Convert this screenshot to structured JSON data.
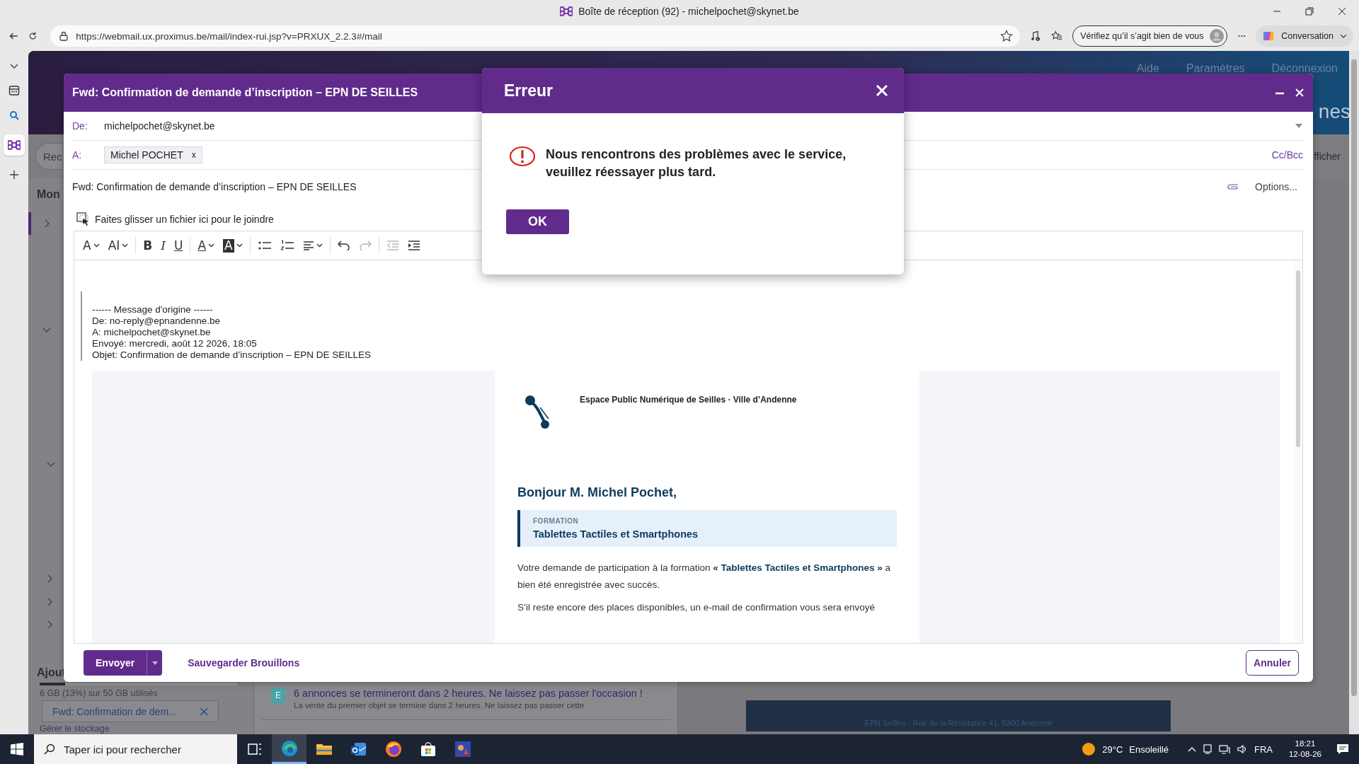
{
  "browser": {
    "tab_title": "Boîte de réception (92) - michelpochet@skynet.be",
    "url": "https://webmail.ux.proximus.be/mail/index-rui.jsp?v=PRXUX_2.2.3#/mail",
    "identity_button": "Vérifiez qu’il s’agit bien de vous",
    "copilot_button": "Conversation"
  },
  "webmail": {
    "header_links": [
      "Aide",
      "Paramètres",
      "Déconnexion"
    ],
    "header_title": "nes",
    "toolbar_button": "Rec",
    "view_menu": "fficher",
    "folder_heading": "Mon",
    "storage_heading": "Ajout",
    "storage": {
      "level": 0.13,
      "text": "6 GB (13%) sur 50 GB utilisés",
      "link": "Gérer le stockage"
    },
    "notification": {
      "badge": "E",
      "title": "6 annonces se termineront dans 2 heures. Ne laissez pas passer l'occasion !",
      "preview": "La vente du premier objet se termine dans 2 heures. Ne laissez pas passer cette"
    },
    "preview_footer": "EPN Seilles · Rue de la Résistance 41, 5300 Andenne",
    "minimized_draft": "Fwd: Confirmation de dem..."
  },
  "compose": {
    "title": "Fwd: Confirmation de demande d’inscription – EPN DE SEILLES",
    "from_label": "De:",
    "from": "michelpochet@skynet.be",
    "to_label": "A:",
    "recipients": [
      {
        "name": "Michel POCHET",
        "remove": "x"
      }
    ],
    "cc_bcc": "Cc/Bcc",
    "subject": "Fwd: Confirmation de demande d’inscription – EPN DE SEILLES",
    "options": "Options...",
    "attach_hint": "Faites glisser un fichier ici pour le joindre",
    "toolbar": [
      {
        "kind": "font",
        "text": "A",
        "disabled": false
      },
      {
        "kind": "size",
        "text": "AI",
        "disabled": false
      },
      {
        "kind": "bold",
        "text": "B",
        "disabled": false
      },
      {
        "kind": "italic",
        "text": "I",
        "disabled": false
      },
      {
        "kind": "underline",
        "text": "U",
        "disabled": false
      },
      {
        "kind": "color",
        "text": "A",
        "disabled": false
      },
      {
        "kind": "highlight",
        "text": "A",
        "disabled": false
      },
      {
        "kind": "bullets",
        "disabled": false
      },
      {
        "kind": "numbers",
        "disabled": false
      },
      {
        "kind": "align",
        "disabled": false
      },
      {
        "kind": "undo",
        "disabled": false
      },
      {
        "kind": "redo",
        "disabled": true
      },
      {
        "kind": "outdent",
        "disabled": true
      },
      {
        "kind": "indent",
        "disabled": false
      }
    ],
    "quote": [
      "------ Message d'origine ------",
      "De: no-reply@epnandenne.be",
      "A: michelpochet@skynet.be",
      "Envoyé: mercredi, août 12 2026, 18:05",
      "Objet: Confirmation de demande d’inscription – EPN DE SEILLES"
    ],
    "email": {
      "organisation": "Espace Public Numérique de Seilles · Ville d’Andenne",
      "greeting": "Bonjour M. Michel Pochet,",
      "formation_label": "FORMATION",
      "formation_title": "Tablettes Tactiles et Smartphones",
      "paragraphs": [
        "Votre demande de participation à la formation **« Tablettes Tactiles et Smartphones »** a bien été enregistrée avec succès.",
        "S’il reste encore des places disponibles, un e-mail de confirmation vous sera envoyé"
      ]
    },
    "send": "Envoyer",
    "save_draft": "Sauvegarder Brouillons",
    "cancel": "Annuler"
  },
  "dialog": {
    "title": "Erreur",
    "message": "Nous rencontrons des problèmes avec le service, veuillez réessayer plus tard.",
    "ok": "OK"
  },
  "taskbar": {
    "search_placeholder": "Taper ici pour rechercher",
    "apps": [
      {
        "kind": "task-view",
        "selected": false
      },
      {
        "kind": "browser",
        "selected": true
      },
      {
        "kind": "folder",
        "selected": false
      },
      {
        "kind": "mail",
        "selected": false
      },
      {
        "kind": "globe",
        "selected": false
      },
      {
        "kind": "store",
        "selected": false
      },
      {
        "kind": "tile",
        "selected": false
      }
    ],
    "temperature": "29°C",
    "weather": "Ensoleillé",
    "language": "FRA",
    "time": "18:21",
    "date": "12-08-26"
  }
}
